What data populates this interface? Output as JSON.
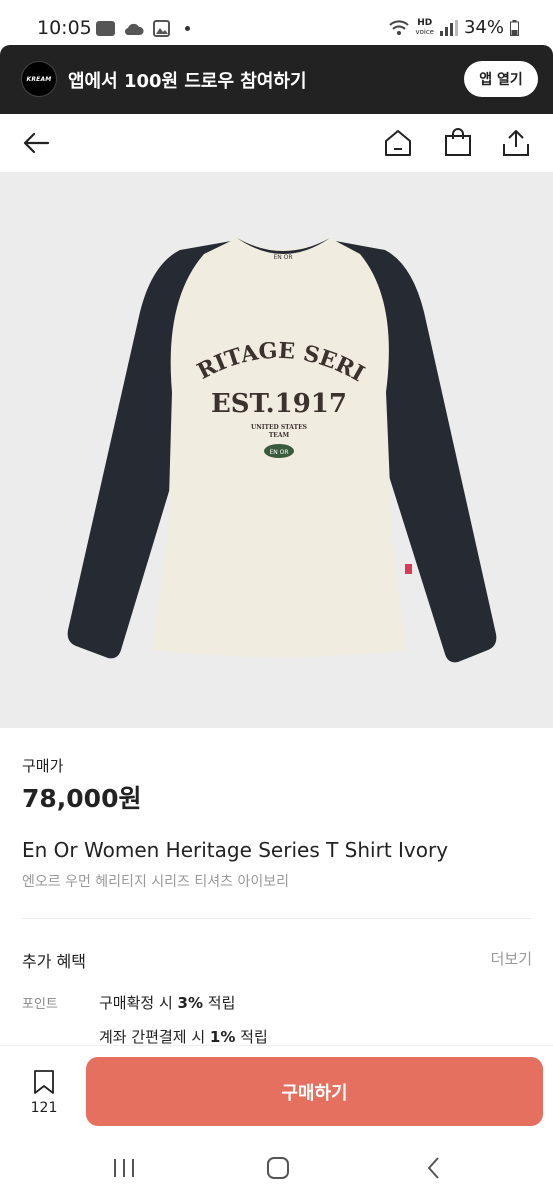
{
  "status_bar": {
    "time": "10:05",
    "battery": "34%",
    "network_label": "HD",
    "network_sublabel": "voice"
  },
  "promo": {
    "logo_text": "KREAM",
    "text": "앱에서 100원 드로우 참여하기",
    "button_label": "앱 열기"
  },
  "nav": {
    "back_icon": "arrow-left-icon",
    "home_icon": "home-icon",
    "bag_icon": "shopping-bag-icon",
    "share_icon": "share-icon"
  },
  "product_image": {
    "neck_tag": "EN OR",
    "graphic_line1": "HERITAGE SERIES",
    "graphic_line2": "EST.1917",
    "graphic_line3": "UNITED STATES",
    "graphic_line4": "TEAM",
    "badge": "EN OR"
  },
  "info": {
    "price_label": "구매가",
    "price": "78,000원",
    "title_en": "En Or Women Heritage Series T Shirt Ivory",
    "title_kr": "엔오르 우먼 헤리티지 시리즈 티셔츠 아이보리",
    "benefit_title": "추가 혜택",
    "benefit_more": "더보기",
    "point_label": "포인트",
    "point_line1_prefix": "구매확정 시 ",
    "point_line1_bold": "3%",
    "point_line1_suffix": " 적립",
    "point_line2_prefix": "계좌 간편결제 시 ",
    "point_line2_bold": "1%",
    "point_line2_suffix": " 적립"
  },
  "bottom_bar": {
    "bookmark_count": "121",
    "buy_label": "구매하기"
  },
  "colors": {
    "accent": "#e5705f",
    "banner": "#222222",
    "sleeve": "#262b33",
    "body": "#f1ece0"
  }
}
